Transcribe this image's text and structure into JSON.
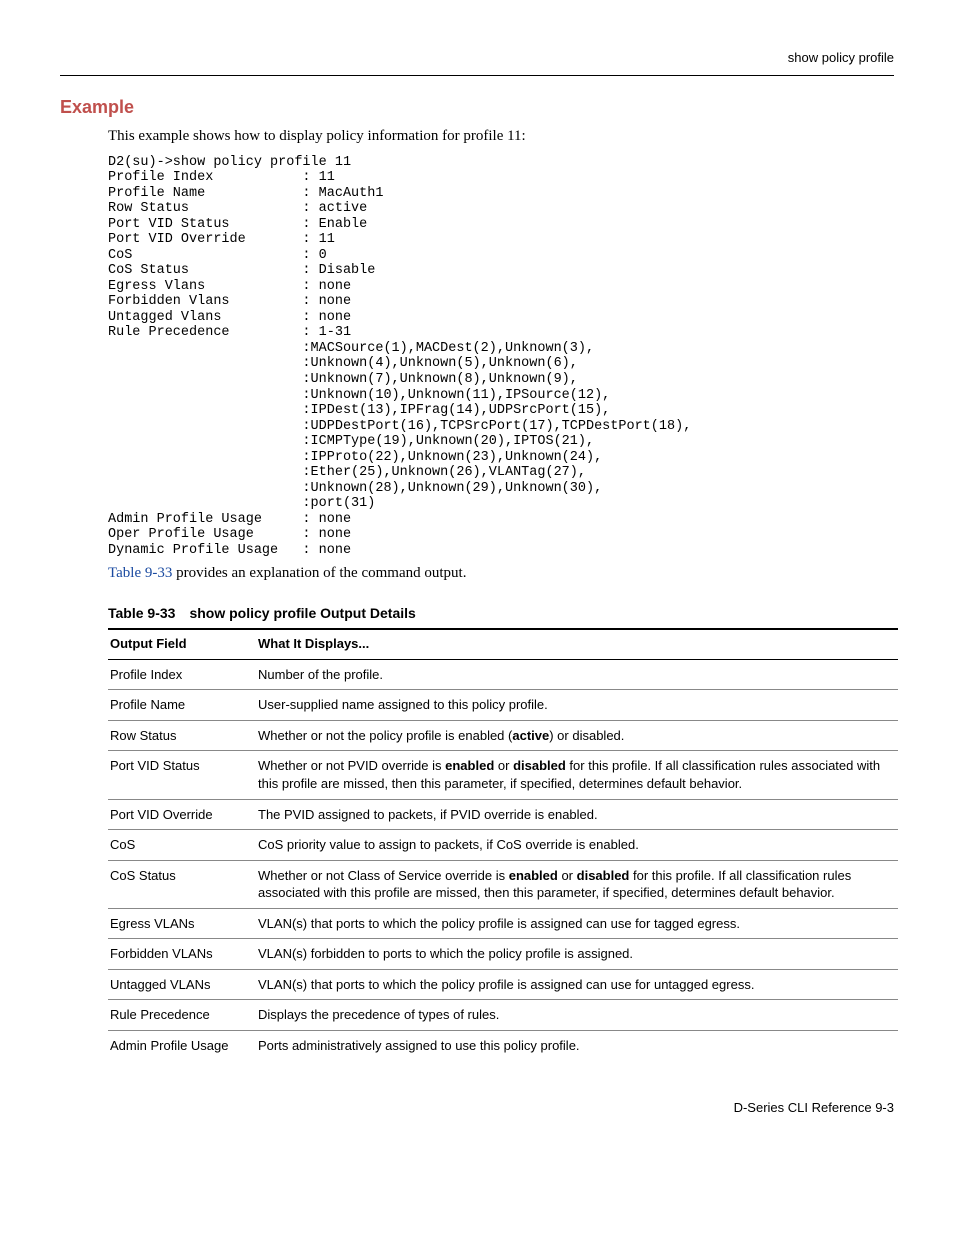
{
  "header": {
    "right": "show policy profile"
  },
  "example": {
    "heading": "Example",
    "intro": "This example shows how to display policy information for profile 11:",
    "output": "D2(su)->show policy profile 11\nProfile Index           : 11\nProfile Name            : MacAuth1\nRow Status              : active\nPort VID Status         : Enable\nPort VID Override       : 11\nCoS                     : 0\nCoS Status              : Disable\nEgress Vlans            : none\nForbidden Vlans         : none\nUntagged Vlans          : none\nRule Precedence         : 1-31\n                        :MACSource(1),MACDest(2),Unknown(3),\n                        :Unknown(4),Unknown(5),Unknown(6),\n                        :Unknown(7),Unknown(8),Unknown(9),\n                        :Unknown(10),Unknown(11),IPSource(12),\n                        :IPDest(13),IPFrag(14),UDPSrcPort(15),\n                        :UDPDestPort(16),TCPSrcPort(17),TCPDestPort(18),\n                        :ICMPType(19),Unknown(20),IPTOS(21),\n                        :IPProto(22),Unknown(23),Unknown(24),\n                        :Ether(25),Unknown(26),VLANTag(27),\n                        :Unknown(28),Unknown(29),Unknown(30),\n                        :port(31)\nAdmin Profile Usage     : none\nOper Profile Usage      : none\nDynamic Profile Usage   : none",
    "outro_pre": " provides an explanation of the command output.",
    "xref": "Table 9-33"
  },
  "table": {
    "captionNum": "Table 9-33",
    "captionText": "show policy profile Output Details",
    "headers": [
      "Output Field",
      "What It Displays..."
    ],
    "rows": [
      {
        "field": "Profile Index",
        "desc_html": "Number of the profile."
      },
      {
        "field": "Profile Name",
        "desc_html": "User-supplied name assigned to this policy profile."
      },
      {
        "field": "Row Status",
        "desc_html": "Whether or not the policy profile is enabled (<b>active</b>) or disabled."
      },
      {
        "field": "Port VID Status",
        "desc_html": "Whether or not PVID override is <b>enabled</b> or <b>disabled</b> for this profile. If all classification rules associated with this profile are missed, then this parameter, if specified, determines default behavior."
      },
      {
        "field": "Port VID Override",
        "desc_html": "The PVID assigned to packets, if PVID override is enabled."
      },
      {
        "field": "CoS",
        "desc_html": "CoS priority value to assign to packets, if CoS override is enabled."
      },
      {
        "field": "CoS Status",
        "desc_html": "Whether or not Class of Service override is <b>enabled</b> or <b>disabled</b> for this profile. If all classification rules associated with this profile are missed, then this parameter, if specified, determines default behavior."
      },
      {
        "field": "Egress VLANs",
        "desc_html": "VLAN(s) that ports to which the policy profile is assigned can use for tagged egress."
      },
      {
        "field": "Forbidden VLANs",
        "desc_html": "VLAN(s) forbidden to ports to which the policy profile is assigned."
      },
      {
        "field": "Untagged VLANs",
        "desc_html": "VLAN(s) that ports to which the policy profile is assigned can use for untagged egress."
      },
      {
        "field": "Rule Precedence",
        "desc_html": "Displays the precedence of types of rules."
      },
      {
        "field": "Admin Profile Usage",
        "desc_html": "Ports administratively assigned to use this policy profile."
      }
    ]
  },
  "footer": {
    "text": "D-Series CLI Reference   9-3"
  }
}
